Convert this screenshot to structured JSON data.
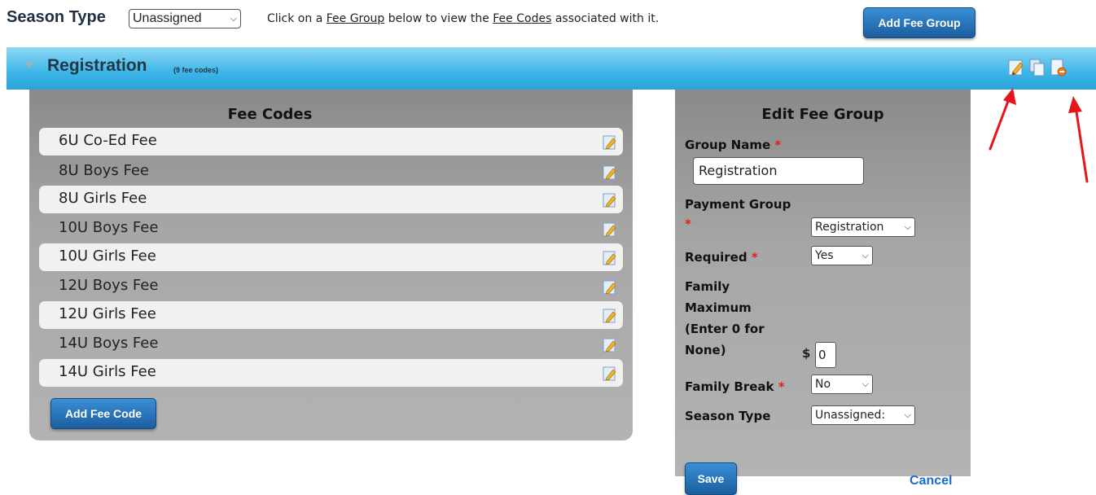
{
  "header": {
    "season_type_label": "Season Type",
    "season_type_value": "Unassigned",
    "instruction_prefix": "Click on a ",
    "instruction_link1": "Fee Group",
    "instruction_middle": " below to view the ",
    "instruction_link2": "Fee Codes",
    "instruction_suffix": " associated with it.",
    "add_fee_group_label": "Add Fee Group"
  },
  "group": {
    "title": "Registration",
    "count": "(9 fee codes)",
    "icons": [
      "edit-icon",
      "copy-icon",
      "delete-icon"
    ]
  },
  "fee_codes": {
    "title": "Fee Codes",
    "items": [
      "6U Co-Ed Fee",
      "8U Boys Fee",
      "8U Girls Fee",
      "10U Boys Fee",
      "10U Girls Fee",
      "12U Boys Fee",
      "12U Girls Fee",
      "14U Boys Fee",
      "14U Girls Fee"
    ],
    "add_label": "Add Fee Code"
  },
  "edit_group": {
    "title": "Edit Fee Group",
    "group_name_label": "Group Name",
    "group_name_value": "Registration",
    "payment_group_label": "Payment Group",
    "payment_group_value": "Registration",
    "required_label": "Required",
    "required_value": "Yes",
    "family_max_line1": "Family",
    "family_max_line2": "Maximum",
    "family_max_line3": "(Enter 0 for",
    "family_max_line4": "None)",
    "currency": "$",
    "family_max_value": "0",
    "family_break_label": "Family Break",
    "family_break_value": "No",
    "season_type_label": "Season Type",
    "season_type_value": "Unassigned:",
    "required_marker": "*",
    "save_label": "Save",
    "cancel_label": "Cancel"
  },
  "colors": {
    "accent_blue": "#1b5e9e",
    "header_bar": "#3cb5e8",
    "required_red": "#e02020",
    "arrow_red": "#e8141b"
  }
}
